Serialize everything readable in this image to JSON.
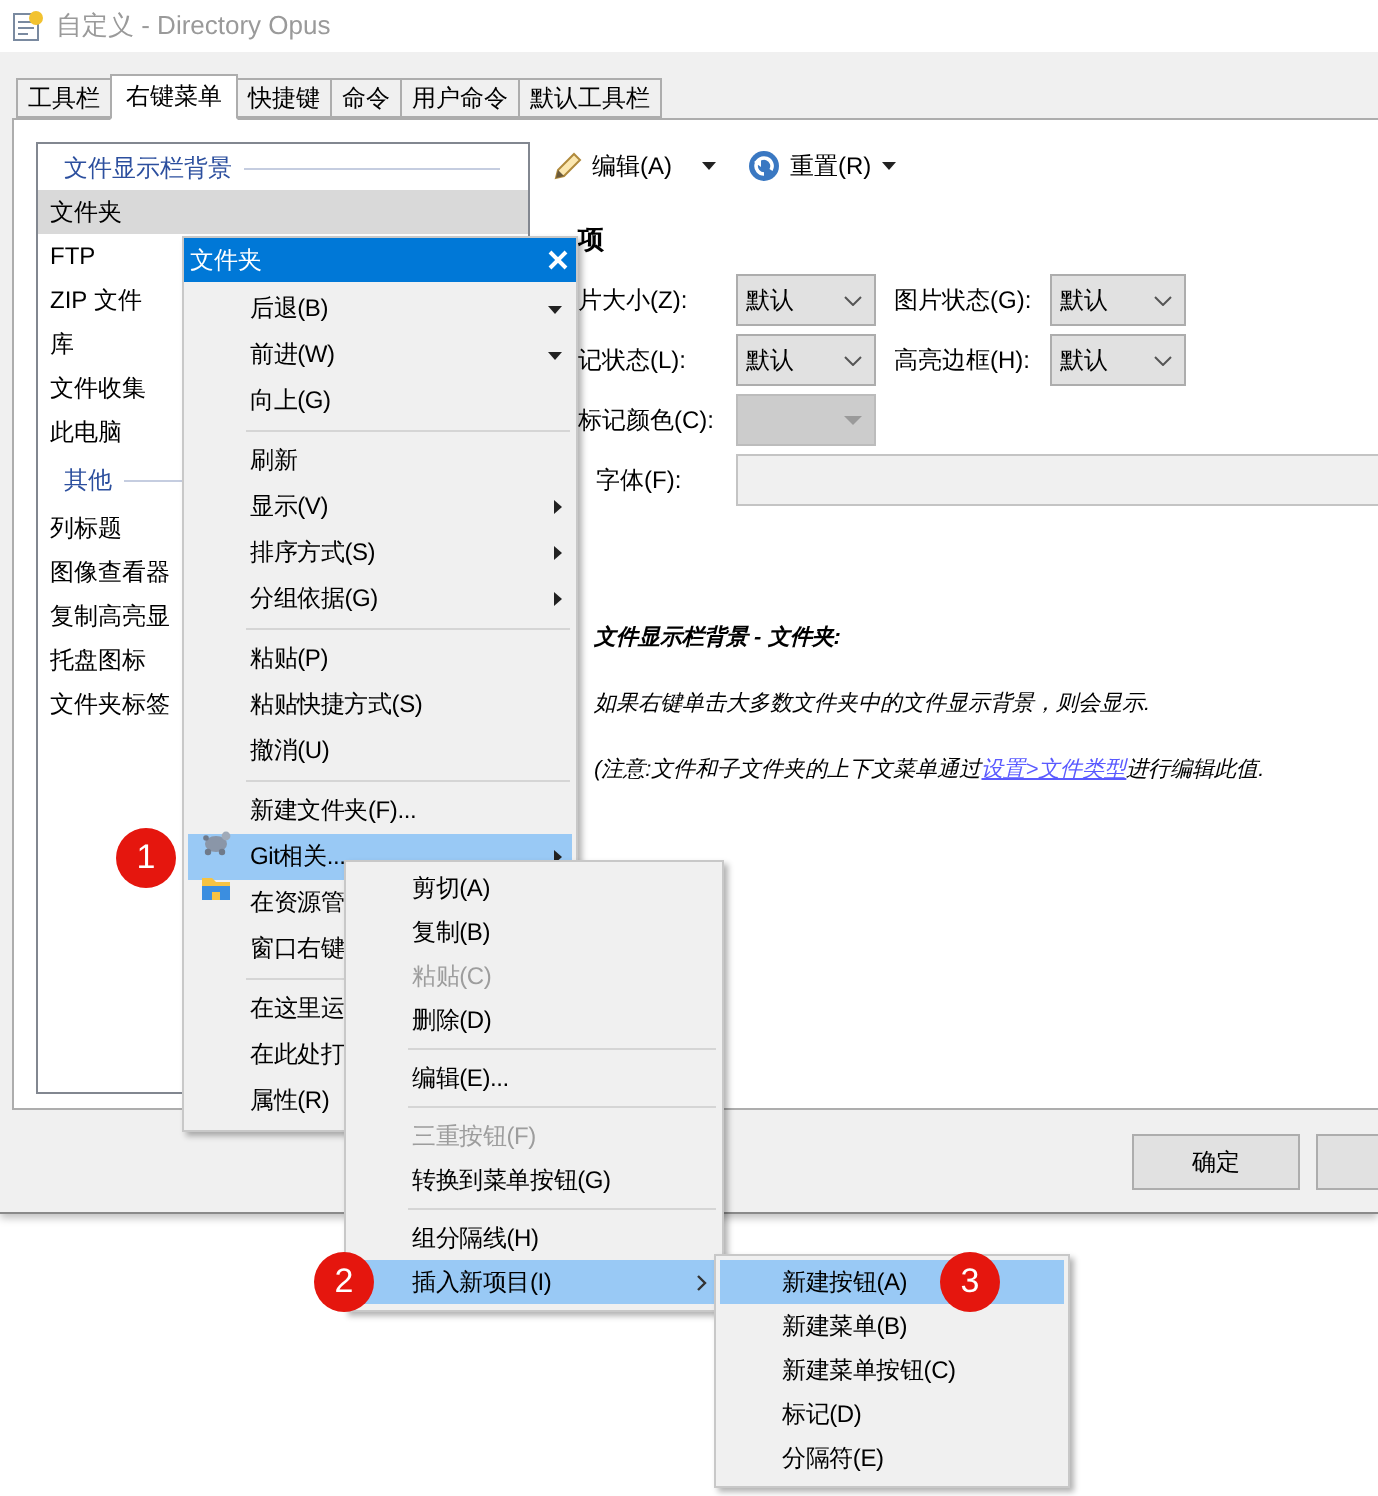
{
  "window": {
    "title": "自定义 - Directory Opus"
  },
  "tabs": [
    {
      "label": "工具栏",
      "selected": false
    },
    {
      "label": "右键菜单",
      "selected": true
    },
    {
      "label": "快捷键",
      "selected": false
    },
    {
      "label": "命令",
      "selected": false
    },
    {
      "label": "用户命令",
      "selected": false
    },
    {
      "label": "默认工具栏",
      "selected": false
    }
  ],
  "list": {
    "groups": [
      {
        "title": "文件显示栏背景",
        "items": [
          {
            "label": "文件夹",
            "selected": true
          },
          {
            "label": "FTP",
            "selected": false
          },
          {
            "label": "ZIP 文件",
            "selected": false
          },
          {
            "label": "库",
            "selected": false
          },
          {
            "label": "文件收集",
            "selected": false
          },
          {
            "label": "此电脑",
            "selected": false
          }
        ]
      },
      {
        "title": "其他",
        "items": [
          {
            "label": "列标题",
            "selected": false
          },
          {
            "label": "图像查看器",
            "selected": false
          },
          {
            "label": "复制高亮显",
            "selected": false
          },
          {
            "label": "托盘图标",
            "selected": false
          },
          {
            "label": "文件夹标签",
            "selected": false
          }
        ]
      }
    ]
  },
  "toolbar": [
    {
      "kind": "edit",
      "label": "编辑(A)"
    },
    {
      "kind": "reset",
      "label": "重置(R)"
    }
  ],
  "settings": {
    "heading": "项",
    "fields": [
      {
        "label": "片大小(Z):",
        "kind": "combo",
        "value": "默认",
        "disabled": false
      },
      {
        "label": "图片状态(G):",
        "kind": "combo",
        "value": "默认",
        "disabled": false
      },
      {
        "label": "记状态(L):",
        "kind": "combo",
        "value": "默认",
        "disabled": false
      },
      {
        "label": "高亮边框(H):",
        "kind": "combo",
        "value": "默认",
        "disabled": false
      },
      {
        "label": "标记颜色(C):",
        "kind": "combo",
        "disabled": true
      },
      {
        "label": "字体(F):",
        "kind": "text"
      }
    ]
  },
  "description": {
    "title": "文件显示栏背景 - 文件夹:",
    "text": "如果右键单击大多数文件夹中的文件显示背景，则会显示.",
    "note": {
      "before": "(注意:文件和子文件夹的上下文菜单通过",
      "link": "设置>文件类型",
      "after": "进行编辑此值."
    }
  },
  "buttons": [
    {
      "kind": "button",
      "label": "确定"
    },
    {
      "kind": "cut-off"
    }
  ],
  "menus": [
    {
      "title": "文件夹",
      "items": [
        {
          "kind": "split",
          "label": "后退(B)",
          "selected": false,
          "disabled": false
        },
        {
          "kind": "split",
          "label": "前进(W)",
          "selected": false,
          "disabled": false
        },
        {
          "kind": "action",
          "label": "向上(G)",
          "selected": false,
          "disabled": false
        },
        {
          "kind": "separator"
        },
        {
          "kind": "action",
          "label": "刷新",
          "selected": false,
          "disabled": false
        },
        {
          "kind": "submenu",
          "label": "显示(V)",
          "selected": false,
          "disabled": false
        },
        {
          "kind": "submenu",
          "label": "排序方式(S)",
          "selected": false,
          "disabled": false
        },
        {
          "kind": "submenu",
          "label": "分组依据(G)",
          "selected": false,
          "disabled": false
        },
        {
          "kind": "separator"
        },
        {
          "kind": "action",
          "label": "粘贴(P)",
          "selected": false,
          "disabled": false
        },
        {
          "kind": "action",
          "label": "粘贴快捷方式(S)",
          "selected": false,
          "disabled": false
        },
        {
          "kind": "action",
          "label": "撤消(U)",
          "selected": false,
          "disabled": false
        },
        {
          "kind": "separator"
        },
        {
          "kind": "action",
          "label": "新建文件夹(F)...",
          "selected": false,
          "disabled": false
        },
        {
          "kind": "submenu",
          "label": "Git相关...",
          "selected": true,
          "disabled": false,
          "badge": "1"
        },
        {
          "kind": "action",
          "label": "在资源管",
          "selected": false,
          "disabled": false
        },
        {
          "kind": "action",
          "label": "窗口右键",
          "selected": false,
          "disabled": false
        },
        {
          "kind": "separator"
        },
        {
          "kind": "action",
          "label": "在这里运",
          "selected": false,
          "disabled": false
        },
        {
          "kind": "action",
          "label": "在此处打",
          "selected": false,
          "disabled": false
        },
        {
          "kind": "action",
          "label": "属性(R)",
          "selected": false,
          "disabled": false
        }
      ]
    },
    {
      "items": [
        {
          "kind": "action",
          "label": "剪切(A)",
          "selected": false,
          "disabled": false
        },
        {
          "kind": "action",
          "label": "复制(B)",
          "selected": false,
          "disabled": false
        },
        {
          "kind": "action",
          "label": "粘贴(C)",
          "selected": false,
          "disabled": true
        },
        {
          "kind": "action",
          "label": "删除(D)",
          "selected": false,
          "disabled": false
        },
        {
          "kind": "separator"
        },
        {
          "kind": "action",
          "label": "编辑(E)...",
          "selected": false,
          "disabled": false
        },
        {
          "kind": "separator"
        },
        {
          "kind": "action",
          "label": "三重按钮(F)",
          "selected": false,
          "disabled": true
        },
        {
          "kind": "action",
          "label": "转换到菜单按钮(G)",
          "selected": false,
          "disabled": false
        },
        {
          "kind": "separator"
        },
        {
          "kind": "action",
          "label": "组分隔线(H)",
          "selected": false,
          "disabled": false
        },
        {
          "kind": "chevron",
          "label": "插入新项目(I)",
          "selected": true,
          "disabled": false,
          "badge": "2"
        }
      ]
    },
    {
      "items": [
        {
          "kind": "action",
          "label": "新建按钮(A)",
          "selected": true,
          "disabled": false,
          "badge": "3"
        },
        {
          "kind": "action",
          "label": "新建菜单(B)",
          "selected": false,
          "disabled": false
        },
        {
          "kind": "action",
          "label": "新建菜单按钮(C)",
          "selected": false,
          "disabled": false
        },
        {
          "kind": "action",
          "label": "标记(D)",
          "selected": false,
          "disabled": false
        },
        {
          "kind": "action",
          "label": "分隔符(E)",
          "selected": false,
          "disabled": false
        }
      ]
    }
  ]
}
